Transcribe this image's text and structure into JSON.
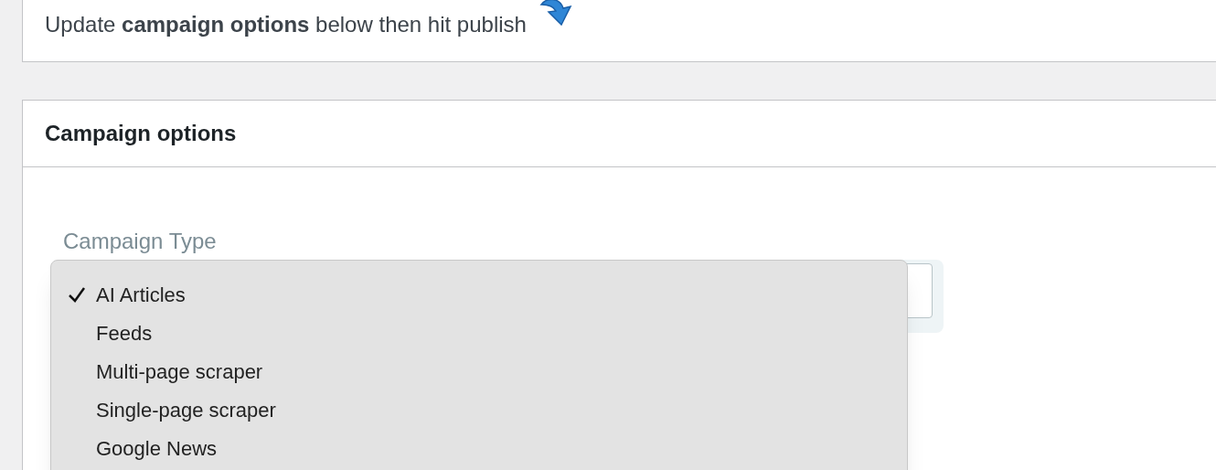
{
  "notice": {
    "text": "Update **campaign options** below then hit publish"
  },
  "panel": {
    "title": "Campaign options"
  },
  "campaign_type": {
    "label": "Campaign Type",
    "options": [
      {
        "label": "AI Articles",
        "selected": true
      },
      {
        "label": "Feeds",
        "selected": false
      },
      {
        "label": "Multi-page scraper",
        "selected": false
      },
      {
        "label": "Single-page scraper",
        "selected": false
      },
      {
        "label": "Google News",
        "selected": false
      }
    ]
  }
}
